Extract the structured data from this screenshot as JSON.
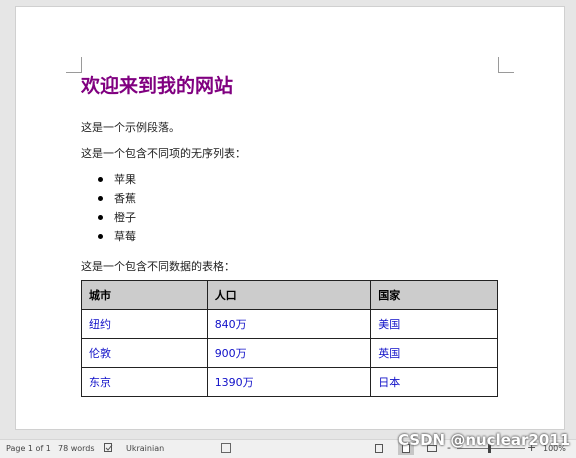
{
  "document": {
    "title": "欢迎来到我的网站",
    "paragraph1": "这是一个示例段落。",
    "list_intro": "这是一个包含不同项的无序列表：",
    "list_items": [
      "苹果",
      "香蕉",
      "橙子",
      "草莓"
    ],
    "table_intro": "这是一个包含不同数据的表格：",
    "table": {
      "headers": [
        "城市",
        "人口",
        "国家"
      ],
      "rows": [
        [
          "纽约",
          "840万",
          "美国"
        ],
        [
          "伦敦",
          "900万",
          "英国"
        ],
        [
          "东京",
          "1390万",
          "日本"
        ]
      ]
    },
    "colors": {
      "title": "#800080",
      "cell_text": "#1010c8",
      "header_bg": "#cccccc"
    }
  },
  "statusbar": {
    "page_info": "Page 1 of 1",
    "word_count": "78 words",
    "language": "Ukrainian",
    "zoom_minus": "-",
    "zoom_plus": "+",
    "zoom_level": "100%"
  },
  "watermark": "CSDN @nuclear2011"
}
